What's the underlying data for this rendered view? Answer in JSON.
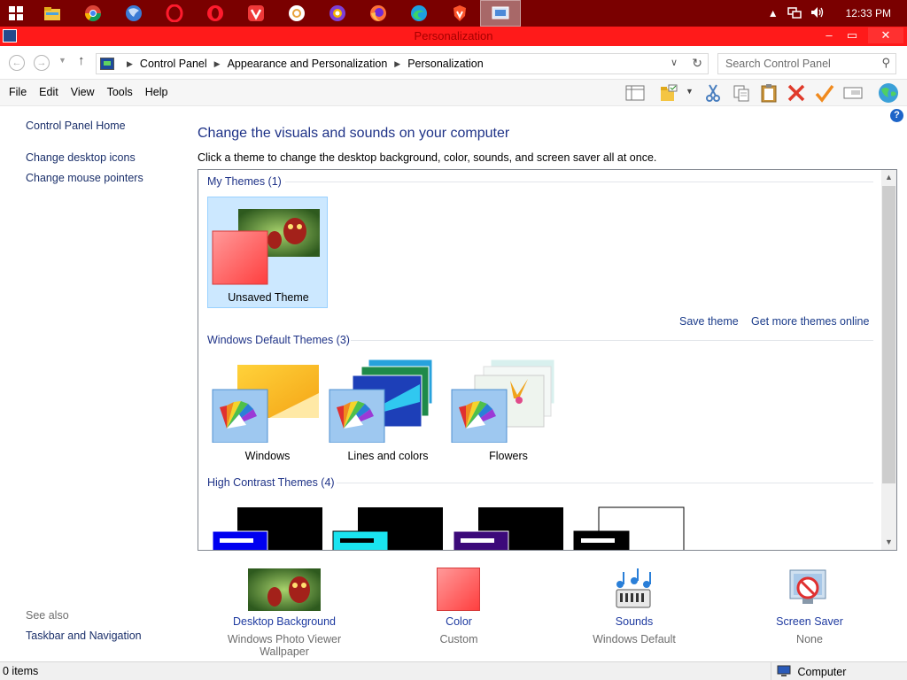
{
  "taskbar": {
    "apps": [
      "file-explorer",
      "chrome",
      "firefox-alt",
      "opera",
      "opera-gx",
      "vivaldi",
      "chromium",
      "brave-beta",
      "firefox",
      "edge",
      "brave",
      "control-panel"
    ],
    "clock": "12:33 PM"
  },
  "window": {
    "title": "Personalization",
    "min_label": "–",
    "max_label": "▭",
    "close_label": "✕"
  },
  "address": {
    "crumbs": [
      "Control Panel",
      "Appearance and Personalization",
      "Personalization"
    ],
    "search_placeholder": "Search Control Panel"
  },
  "menu": [
    "File",
    "Edit",
    "View",
    "Tools",
    "Help"
  ],
  "left": {
    "home": "Control Panel Home",
    "desktop_icons": "Change desktop icons",
    "mouse_pointers": "Change mouse pointers",
    "see_also": "See also",
    "taskbar_nav": "Taskbar and Navigation"
  },
  "main": {
    "heading": "Change the visuals and sounds on your computer",
    "subheading": "Click a theme to change the desktop background, color, sounds, and screen saver all at once.",
    "groups": {
      "my": "My Themes (1)",
      "default": "Windows Default Themes (3)",
      "contrast": "High Contrast Themes (4)"
    },
    "themes": {
      "unsaved": "Unsaved Theme",
      "windows": "Windows",
      "lines": "Lines and colors",
      "flowers": "Flowers"
    },
    "save_theme": "Save theme",
    "get_more": "Get more themes online"
  },
  "bottom": {
    "bg_label": "Desktop Background",
    "bg_sub": "Windows Photo Viewer Wallpaper",
    "color_label": "Color",
    "color_sub": "Custom",
    "sounds_label": "Sounds",
    "sounds_sub": "Windows Default",
    "ss_label": "Screen Saver",
    "ss_sub": "None"
  },
  "status": {
    "items": "0 items",
    "location": "Computer"
  },
  "colors": {
    "taskbar": "#7a0000",
    "titlebar": "#ff1a1a",
    "link": "#1e3287",
    "selection": "#cce8ff",
    "accent_swatch": "#ff6666"
  }
}
